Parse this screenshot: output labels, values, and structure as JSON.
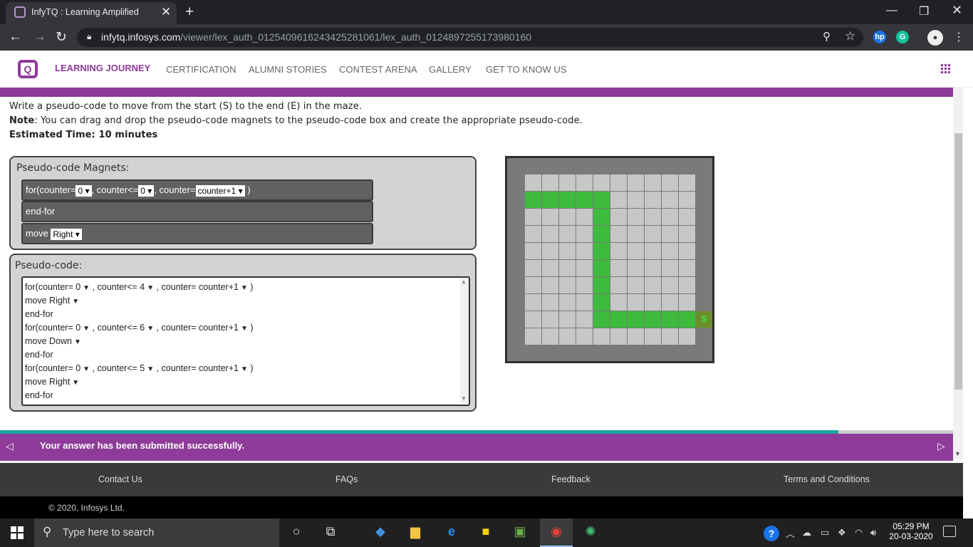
{
  "browser": {
    "tab_title": "InfyTQ : Learning Amplified",
    "url_host": "infytq.infosys.com",
    "url_path": "/viewer/lex_auth_012540961624342528106​1/lex_auth_0124897255173980160"
  },
  "site": {
    "nav": [
      "LEARNING JOURNEY",
      "CERTIFICATION",
      "ALUMNI STORIES",
      "CONTEST ARENA",
      "GALLERY",
      "GET TO KNOW US"
    ]
  },
  "instructions": {
    "line1": "Write a pseudo-code to move from the start (S) to the end (E) in the maze.",
    "note_label": "Note",
    "note_text": ": You can drag and drop the pseudo-code magnets to the pseudo-code box and create the appropriate pseudo-code.",
    "time": "Estimated Time: 10 minutes"
  },
  "magnets": {
    "title": "Pseudo-code Magnets:",
    "for_prefix": "for(counter=",
    "for_start": "0",
    "for_mid": ", counter<=",
    "for_end": "0",
    "for_step_label": ", counter=",
    "for_step": "counter+1",
    "for_close": ")",
    "endfor": "end-for",
    "move_label": "move",
    "move_dir": "Right"
  },
  "pseudocode": {
    "title": "Pseudo-code:",
    "lines": [
      {
        "type": "for",
        "end": "4"
      },
      {
        "type": "move",
        "dir": "Right"
      },
      {
        "type": "endfor"
      },
      {
        "type": "for",
        "end": "6"
      },
      {
        "type": "move",
        "dir": "Down"
      },
      {
        "type": "endfor"
      },
      {
        "type": "for",
        "end": "5"
      },
      {
        "type": "move",
        "dir": "Right"
      },
      {
        "type": "endfor"
      }
    ]
  },
  "maze": {
    "rows": 10,
    "cols": 10,
    "path_cells": [
      [
        1,
        0
      ],
      [
        1,
        1
      ],
      [
        1,
        2
      ],
      [
        1,
        3
      ],
      [
        1,
        4
      ],
      [
        2,
        4
      ],
      [
        3,
        4
      ],
      [
        4,
        4
      ],
      [
        5,
        4
      ],
      [
        6,
        4
      ],
      [
        7,
        4
      ],
      [
        8,
        4
      ],
      [
        8,
        5
      ],
      [
        8,
        6
      ],
      [
        8,
        7
      ],
      [
        8,
        8
      ],
      [
        8,
        9
      ]
    ],
    "start_label": "S",
    "colors": {
      "path": "#3dbb3d",
      "cell": "#c7c7c7",
      "wall": "#7a7a7a"
    }
  },
  "progress": 0.88,
  "notification": "Your answer has been submitted successfully.",
  "footer": {
    "links": [
      "Contact Us",
      "FAQs",
      "Feedback",
      "Terms and Conditions"
    ],
    "copyright": "© 2020, Infosys Ltd."
  },
  "taskbar": {
    "search": "Type here to search",
    "time": "05:29 PM",
    "date": "20-03-2020"
  }
}
